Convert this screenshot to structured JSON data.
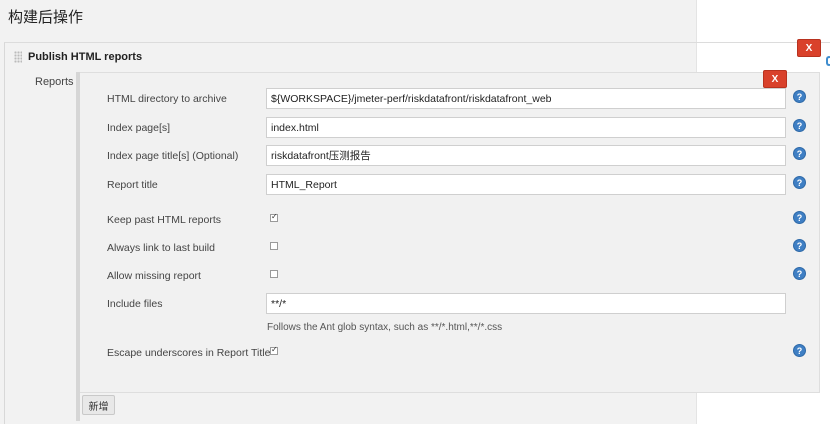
{
  "section": {
    "title": "构建后操作"
  },
  "publish": {
    "header": "Publish HTML reports",
    "delete_label": "X",
    "reports_label": "Reports",
    "report_delete_label": "X",
    "add_label": "新增"
  },
  "fields": {
    "html_dir": {
      "label": "HTML directory to archive",
      "value": "${WORKSPACE}/jmeter-perf/riskdatafront/riskdatafront_web"
    },
    "index_pages": {
      "label": "Index page[s]",
      "value": "index.html"
    },
    "index_titles": {
      "label": "Index page title[s] (Optional)",
      "value": "riskdatafront压测报告"
    },
    "report_title": {
      "label": "Report title",
      "value": "HTML_Report"
    },
    "keep_past": {
      "label": "Keep past HTML reports",
      "checked": true
    },
    "always_link": {
      "label": "Always link to last build",
      "checked": false
    },
    "allow_missing": {
      "label": "Allow missing report",
      "checked": false
    },
    "include_files": {
      "label": "Include files",
      "value": "**/*",
      "hint": "Follows the Ant glob syntax, such as **/*.html,**/*.css"
    },
    "escape_underscores": {
      "label": "Escape underscores in Report Title",
      "checked": true
    }
  },
  "help_icon": "?",
  "colors": {
    "delete": "#d9412b",
    "help": "#3f7fc4"
  },
  "icons": {
    "help": "question-circle-icon",
    "delete": "close-icon",
    "grip": "drag-handle-icon"
  }
}
